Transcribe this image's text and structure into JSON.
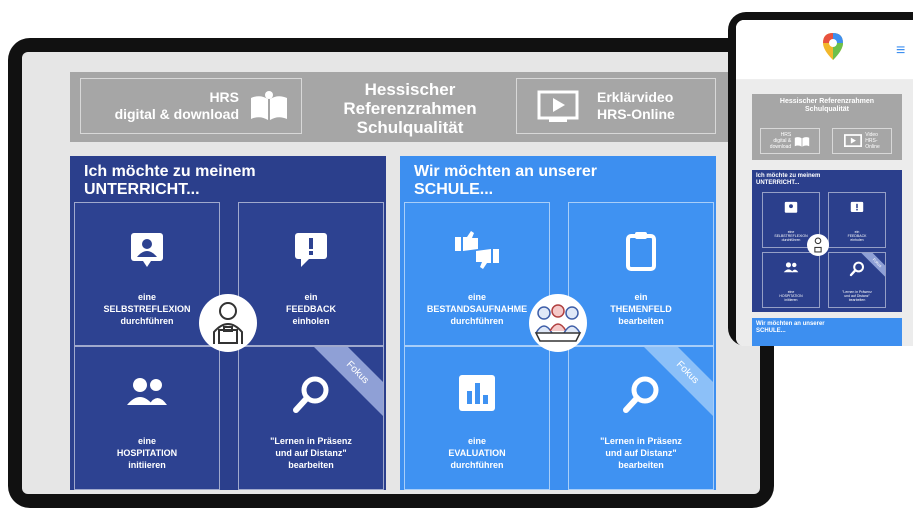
{
  "banner": {
    "left_label_line1": "HRS",
    "left_label_line2": "digital & download",
    "title_line1": "Hessischer",
    "title_line2": "Referenzrahmen",
    "title_line3": "Schulqualität",
    "right_label_line1": "Erklärvideo",
    "right_label_line2": "HRS-Online"
  },
  "unterricht": {
    "title_line1": "Ich möchte zu meinem",
    "title_line2": "UNTERRICHT...",
    "tiles": [
      {
        "line1": "eine",
        "line2": "SELBSTREFLEXION",
        "line3": "durchführen",
        "icon": "person-card-icon"
      },
      {
        "line1": "ein",
        "line2": "FEEDBACK",
        "line3": "einholen",
        "icon": "exclamation-speech-icon"
      },
      {
        "line1": "eine",
        "line2": "HOSPITATION",
        "line3": "initiieren",
        "icon": "people-icon"
      },
      {
        "line1": "\"Lernen in Präsenz",
        "line2": "und auf Distanz\"",
        "line3": "bearbeiten",
        "icon": "magnifier-icon",
        "ribbon": "Fokus"
      }
    ]
  },
  "schule": {
    "title_line1": "Wir möchten an unserer",
    "title_line2": "SCHULE...",
    "tiles": [
      {
        "line1": "eine",
        "line2": "BESTANDSAUFNAHME",
        "line3": "durchführen",
        "icon": "thumbs-icon"
      },
      {
        "line1": "ein",
        "line2": "THEMENFELD",
        "line3": "bearbeiten",
        "icon": "clipboard-icon"
      },
      {
        "line1": "eine",
        "line2": "EVALUATION",
        "line3": "durchführen",
        "icon": "bar-chart-icon"
      },
      {
        "line1": "\"Lernen in Präsenz",
        "line2": "und auf Distanz\"",
        "line3": "bearbeiten",
        "icon": "magnifier-icon",
        "ribbon": "Fokus"
      }
    ]
  },
  "mobile": {
    "menu_glyph": "≡",
    "banner_title_line1": "Hessischer Referenzrahmen",
    "banner_title_line2": "Schulqualität",
    "left_box_line1": "HRS",
    "left_box_line2": "digital &",
    "left_box_line3": "download",
    "right_box_line1": "Video",
    "right_box_line2": "HRS-",
    "right_box_line3": "Online",
    "panel_title_line1": "Ich möchte zu meinem",
    "panel_title_line2": "UNTERRICHT...",
    "tiles": [
      {
        "line1": "eine",
        "line2": "SELBSTREFLEXION",
        "line3": "durchführen"
      },
      {
        "line1": "ein",
        "line2": "FEEDBACK",
        "line3": "einholen"
      },
      {
        "line1": "eine",
        "line2": "HOSPITATION",
        "line3": "initiieren"
      },
      {
        "line1": "\"Lernen in Präsenz",
        "line2": "und auf Distanz\"",
        "line3": "bearbeiten"
      }
    ],
    "ribbon": "Fokus",
    "panel2_title_line1": "Wir möchten an unserer",
    "panel2_title_line2": "SCHULE..."
  },
  "colors": {
    "dark_blue": "#2b3f8c",
    "light_blue": "#3d8ff0",
    "banner_gray": "#a6a6a6",
    "screen_bg": "#e6e6e6"
  }
}
